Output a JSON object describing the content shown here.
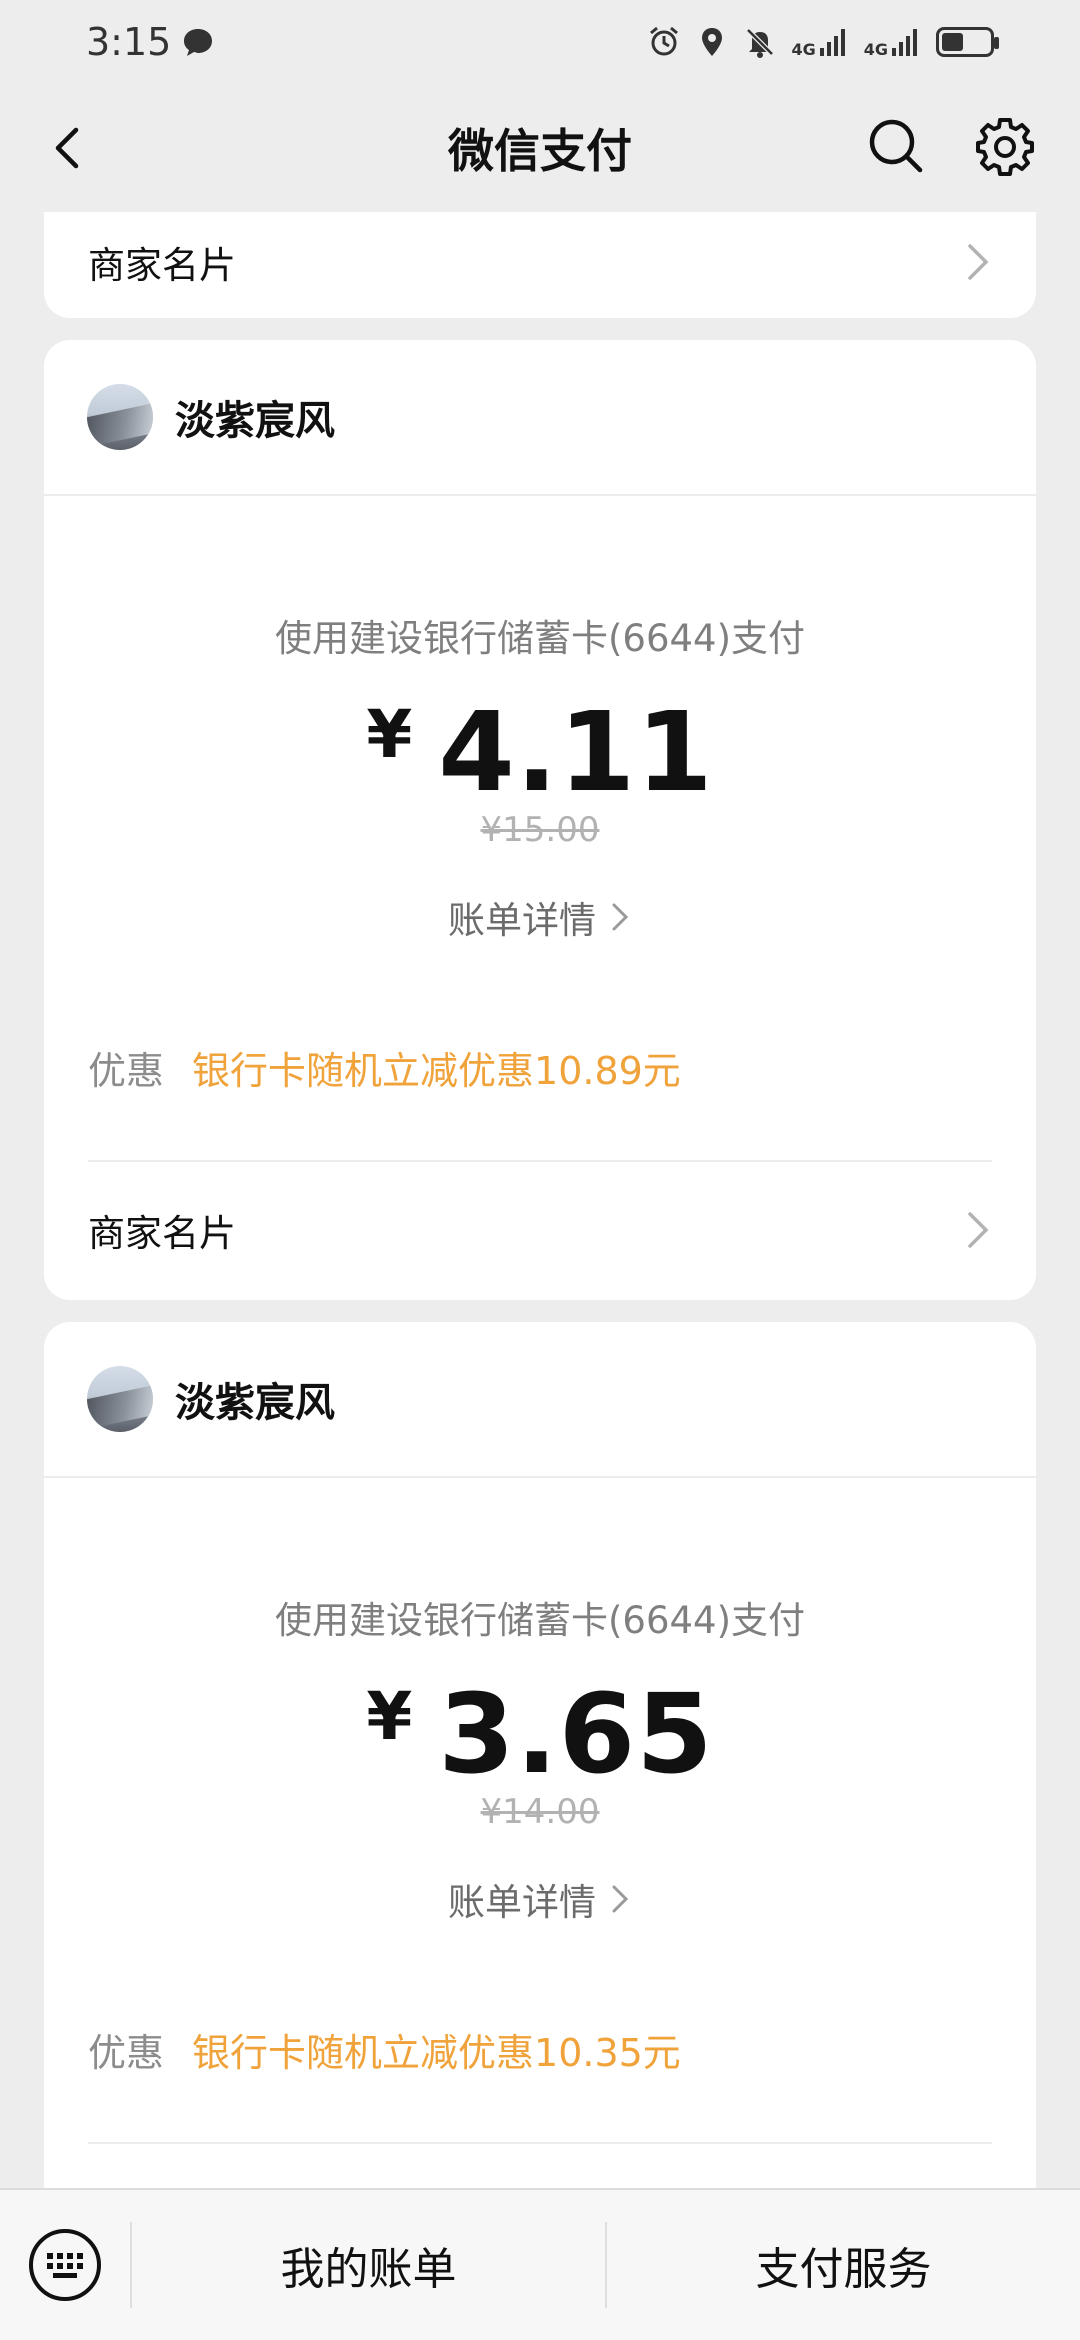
{
  "status_bar": {
    "time": "3:15",
    "network_1": "4G",
    "network_2": "4G",
    "battery_level": 0.45
  },
  "nav": {
    "title": "微信支付"
  },
  "top_card": {
    "merchant_card_label": "商家名片"
  },
  "transactions": [
    {
      "shop_name": "淡紫宸风",
      "pay_method": "使用建设银行储蓄卡(6644)支付",
      "currency": "¥",
      "amount": "4.11",
      "original": "¥15.00",
      "bill_detail": "账单详情",
      "discount_label": "优惠",
      "discount_text": "银行卡随机立减优惠10.89元",
      "merchant_card_label": "商家名片"
    },
    {
      "shop_name": "淡紫宸风",
      "pay_method": "使用建设银行储蓄卡(6644)支付",
      "currency": "¥",
      "amount": "3.65",
      "original": "¥14.00",
      "bill_detail": "账单详情",
      "discount_label": "优惠",
      "discount_text": "银行卡随机立减优惠10.35元"
    }
  ],
  "bottom_bar": {
    "my_bills": "我的账单",
    "pay_services": "支付服务"
  },
  "colors": {
    "accent_orange": "#f0a23b",
    "background": "#ededed"
  }
}
